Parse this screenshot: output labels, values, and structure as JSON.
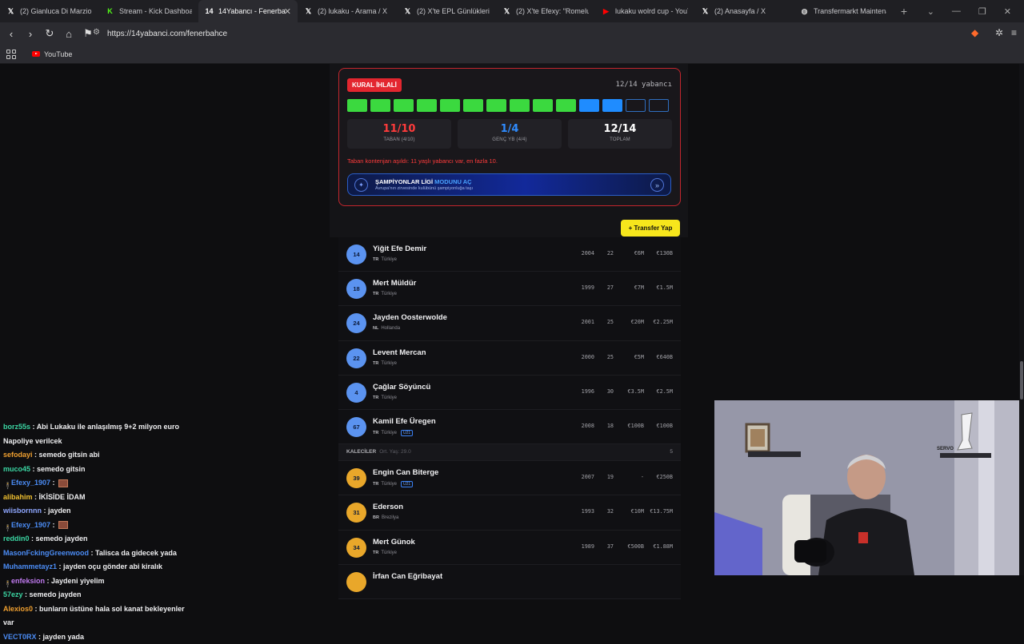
{
  "browser": {
    "tabs": [
      {
        "title": "(2) Gianluca Di Marzio (@",
        "icon": "x-icon",
        "active": false
      },
      {
        "title": "Stream - Kick Dashboard",
        "icon": "kick-icon",
        "active": false
      },
      {
        "title": "14Yabancı - Fenerba",
        "icon": "14-icon",
        "active": true
      },
      {
        "title": "(2) lukaku - Arama / X",
        "icon": "x-icon",
        "active": false
      },
      {
        "title": "(2) X'te EPL Günlükleri: \"M",
        "icon": "x-icon",
        "active": false
      },
      {
        "title": "(2) X'te Efexy: \"Romelu Lu",
        "icon": "x-icon",
        "active": false
      },
      {
        "title": "lukaku wolrd cup - YouTu",
        "icon": "youtube-icon",
        "active": false
      },
      {
        "title": "(2) Anasayfa / X",
        "icon": "x-icon",
        "active": false
      },
      {
        "title": "Transfermarkt Maintenanc",
        "icon": "globe-icon",
        "active": false
      }
    ],
    "url": "https://14yabanci.com/fenerbahce",
    "bookmark": "YouTube"
  },
  "rule_card": {
    "badge": "KURAL İHLALİ",
    "count": "12/14 yabancı",
    "slots": [
      "green",
      "green",
      "green",
      "green",
      "green",
      "green",
      "green",
      "green",
      "green",
      "green",
      "blue",
      "blue",
      "empty",
      "empty"
    ],
    "stats": [
      {
        "value": "11/10",
        "label": "TABAN (4/10)",
        "color": "#ff3b3b"
      },
      {
        "value": "1/4",
        "label": "GENÇ YB (4/4)",
        "color": "#2f8cff"
      },
      {
        "value": "12/14",
        "label": "TOPLAM",
        "color": "#ffffff"
      }
    ],
    "warning": "Taban kontenjan aşıldı: 11 yaşlı yabancı var, en fazla 10.",
    "cl_banner": {
      "title_a": "ŞAMPİYONLAR LİGİ ",
      "title_b": "MODUNU AÇ",
      "sub": "Avrupa'nın zirvesinde kulübünü şampiyonluğa taşı"
    }
  },
  "transfer_button": "+ Transfer Yap",
  "players_top": [
    {
      "num": "14",
      "name": "Yiğit Efe Demir",
      "cc": "TR",
      "country": "Türkiye",
      "u21": false,
      "year": "2004",
      "age": "22",
      "value": "€6M",
      "fee": "€130B"
    },
    {
      "num": "18",
      "name": "Mert Müldür",
      "cc": "TR",
      "country": "Türkiye",
      "u21": false,
      "year": "1999",
      "age": "27",
      "value": "€7M",
      "fee": "€1.5M"
    },
    {
      "num": "24",
      "name": "Jayden Oosterwolde",
      "cc": "NL",
      "country": "Hollanda",
      "u21": false,
      "year": "2001",
      "age": "25",
      "value": "€20M",
      "fee": "€2.25M"
    },
    {
      "num": "22",
      "name": "Levent Mercan",
      "cc": "TR",
      "country": "Türkiye",
      "u21": false,
      "year": "2000",
      "age": "25",
      "value": "€5M",
      "fee": "€640B"
    },
    {
      "num": "4",
      "name": "Çağlar Söyüncü",
      "cc": "TR",
      "country": "Türkiye",
      "u21": false,
      "year": "1996",
      "age": "30",
      "value": "€3.5M",
      "fee": "€2.5M"
    },
    {
      "num": "67",
      "name": "Kamil Efe Üregen",
      "cc": "TR",
      "country": "Türkiye",
      "u21": true,
      "year": "2008",
      "age": "18",
      "value": "€100B",
      "fee": "€100B"
    }
  ],
  "keepers_header": {
    "title": "KALECİLER",
    "sub": "Ort. Yaş: 29.0",
    "count": "5"
  },
  "players_gk": [
    {
      "num": "39",
      "name": "Engin Can Biterge",
      "cc": "TR",
      "country": "Türkiye",
      "u21": true,
      "year": "2007",
      "age": "19",
      "value": "-",
      "fee": "€250B"
    },
    {
      "num": "31",
      "name": "Ederson",
      "cc": "BR",
      "country": "Brezilya",
      "u21": false,
      "year": "1993",
      "age": "32",
      "value": "€10M",
      "fee": "€13.75M"
    },
    {
      "num": "34",
      "name": "Mert Günok",
      "cc": "TR",
      "country": "Türkiye",
      "u21": false,
      "year": "1989",
      "age": "37",
      "value": "€500B",
      "fee": "€1.88M"
    },
    {
      "num": "",
      "name": "İrfan Can Eğribayat",
      "cc": "",
      "country": "",
      "u21": false,
      "year": "",
      "age": "",
      "value": "",
      "fee": ""
    }
  ],
  "chat": [
    {
      "user": "borz55s",
      "color": "#3bd6a3",
      "text": "Abi Lukaku ile anlaşılmış 9+2 milyon euro Napoliye verilcek",
      "badge": false,
      "emote": false
    },
    {
      "user": "sefodayi",
      "color": "#f0a030",
      "text": "semedo gitsin abi",
      "badge": false,
      "emote": false
    },
    {
      "user": "muco45",
      "color": "#3bd6a3",
      "text": "semedo gitsin",
      "badge": false,
      "emote": false
    },
    {
      "user": "Efexy_1907",
      "color": "#4b8cf5",
      "text": "",
      "badge": true,
      "emote": true
    },
    {
      "user": "alibahim",
      "color": "#f0c030",
      "text": "İKİSİDE İDAM",
      "badge": false,
      "emote": false
    },
    {
      "user": "wiisbornnn",
      "color": "#8fa7ff",
      "text": "jayden",
      "badge": false,
      "emote": false
    },
    {
      "user": "Efexy_1907",
      "color": "#4b8cf5",
      "text": "",
      "badge": true,
      "emote": true
    },
    {
      "user": "reddin0",
      "color": "#3bd6a3",
      "text": "semedo jayden",
      "badge": false,
      "emote": false
    },
    {
      "user": "MasonFckingGreenwood",
      "color": "#4b8cf5",
      "text": "Talisca da gidecek yada",
      "badge": false,
      "emote": false
    },
    {
      "user": "Muhammetayz1",
      "color": "#4b8cf5",
      "text": "jayden oçu gönder abi kiralık",
      "badge": false,
      "emote": false
    },
    {
      "user": "enfeksion",
      "color": "#c07af0",
      "text": "Jaydeni yiyelim",
      "badge": true,
      "emote": false
    },
    {
      "user": "57ezy",
      "color": "#3bd6a3",
      "text": "semedo jayden",
      "badge": false,
      "emote": false
    },
    {
      "user": "Alexios0",
      "color": "#f0a030",
      "text": "bunların üstüne hala sol kanat bekleyenler var",
      "badge": false,
      "emote": false
    },
    {
      "user": "VECT0RX",
      "color": "#4b8cf5",
      "text": "jayden yada",
      "badge": false,
      "emote": false
    }
  ]
}
